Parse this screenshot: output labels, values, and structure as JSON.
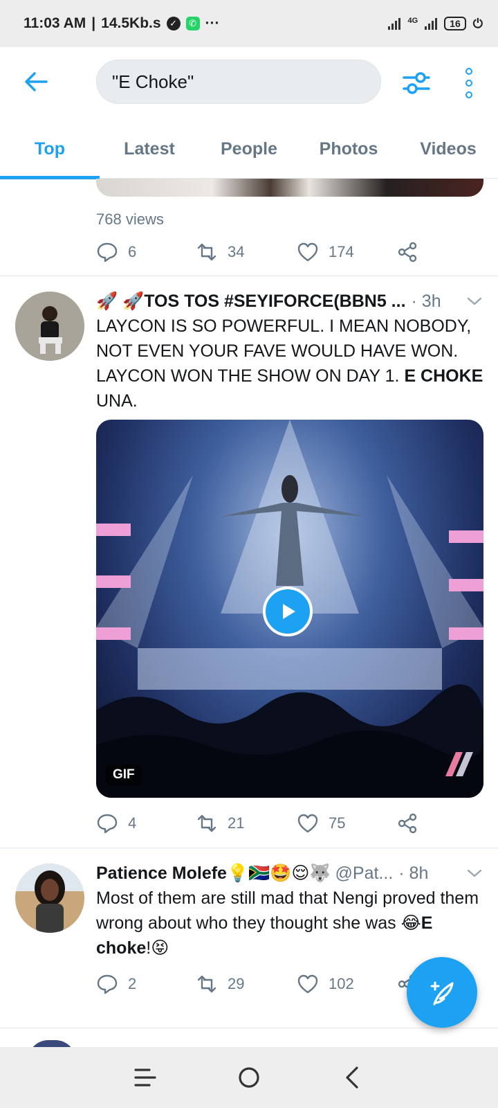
{
  "status_bar": {
    "time": "11:03 AM",
    "speed": "14.5Kb.s",
    "more": "···",
    "network": "4G",
    "battery": "16"
  },
  "header": {
    "search_value": "\"E Choke\""
  },
  "tabs": [
    "Top",
    "Latest",
    "People",
    "Photos",
    "Videos"
  ],
  "prev_tweet": {
    "views": "768 views",
    "reply_count": "6",
    "retweet_count": "34",
    "like_count": "174"
  },
  "tweets": [
    {
      "name": "🚀 🚀TOS TOS #SEYIFORCE(BBN5 ...",
      "handle": "",
      "time": "· 3h",
      "text_1": "LAYCON IS SO POWERFUL. I MEAN NOBODY, NOT EVEN YOUR FAVE WOULD HAVE WON. LAYCON WON THE SHOW ON DAY 1. ",
      "text_bold": "E CHOKE",
      "text_2": " UNA.",
      "media_badge": "GIF",
      "reply_count": "4",
      "retweet_count": "21",
      "like_count": "75"
    },
    {
      "name": "Patience Molefe💡🇿🇦🤩😌🐺",
      "handle": "@Pat...",
      "time": "· 8h",
      "text_1": "Most of them are still mad that Nengi proved them wrong about who they thought she was 😂",
      "text_bold": "E choke",
      "text_2": "!😝",
      "reply_count": "2",
      "retweet_count": "29",
      "like_count": "102"
    }
  ],
  "colors": {
    "accent": "#1da1f2",
    "muted": "#657786",
    "text": "#14171a"
  }
}
